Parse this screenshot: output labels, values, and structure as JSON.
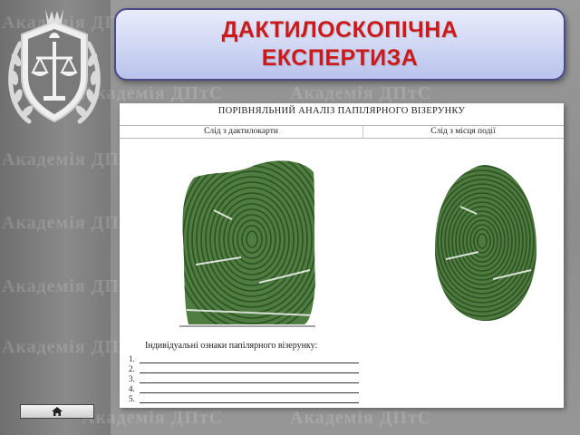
{
  "watermark": {
    "text": "Академія ДПтС"
  },
  "header": {
    "title_line1": "ДАКТИЛОСКОПІЧНА",
    "title_line2": "ЕКСПЕРТИЗА"
  },
  "document": {
    "heading": "ПОРІВНЯЛЬНИЙ АНАЛІЗ ПАПІЛЯРНОГО ВІЗЕРУНКУ",
    "col_left": "Слід з дактилокарти",
    "col_right": "Слід з місця події",
    "features_title": "Індивідуальні ознаки папілярного візерунку:",
    "feature_numbers": [
      "1.",
      "2.",
      "3.",
      "4.",
      "5."
    ]
  },
  "nav": {
    "home_icon": "home-icon"
  },
  "colors": {
    "title_red": "#cc1a1a",
    "title_box_border": "#4a4a8a",
    "fingerprint_green": "#3f6e32"
  }
}
